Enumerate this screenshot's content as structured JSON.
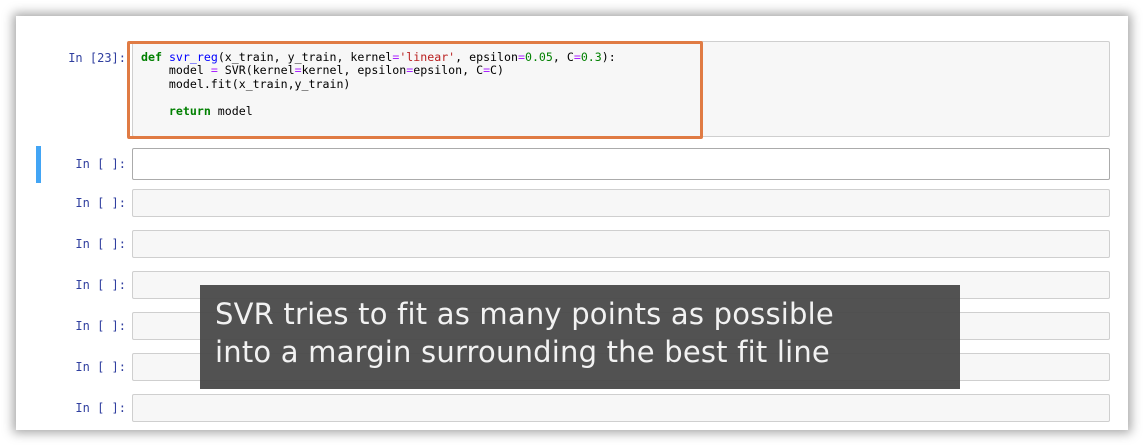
{
  "code_cell": {
    "prompt": "In [23]:",
    "code": {
      "line1": {
        "def": "def",
        "name": "svr_reg",
        "args_a": "(x_train, y_train, kernel",
        "eq1": "=",
        "kernel_str": "'linear'",
        "args_b": ", epsilon",
        "eq2": "=",
        "epsilon_val": "0.05",
        "args_c": ", C",
        "eq3": "=",
        "c_val": "0.3",
        "args_end": "):"
      },
      "line2": {
        "a": "    model ",
        "eq1": "=",
        "b": " SVR(kernel",
        "eq2": "=",
        "c": "kernel, epsilon",
        "eq3": "=",
        "d": "epsilon, C",
        "eq4": "=",
        "e": "C)"
      },
      "line3": "    model.fit(x_train,y_train)",
      "line5": {
        "indent": "    ",
        "return": "return",
        "rest": " model"
      }
    }
  },
  "empty_cells": [
    {
      "prompt": "In [ ]:"
    },
    {
      "prompt": "In [ ]:"
    },
    {
      "prompt": "In [ ]:"
    },
    {
      "prompt": "In [ ]:"
    },
    {
      "prompt": "In [ ]:"
    },
    {
      "prompt": "In [ ]:"
    },
    {
      "prompt": "In [ ]:"
    }
  ],
  "caption": {
    "line1": "SVR tries to fit as many points as possible",
    "line2": "into a margin surrounding the best fit line"
  },
  "colors": {
    "highlight_border": "#e07b44",
    "selected_cell_bar": "#42a5f5",
    "prompt_text": "#303f9f",
    "caption_background": "#4b4b4b"
  }
}
